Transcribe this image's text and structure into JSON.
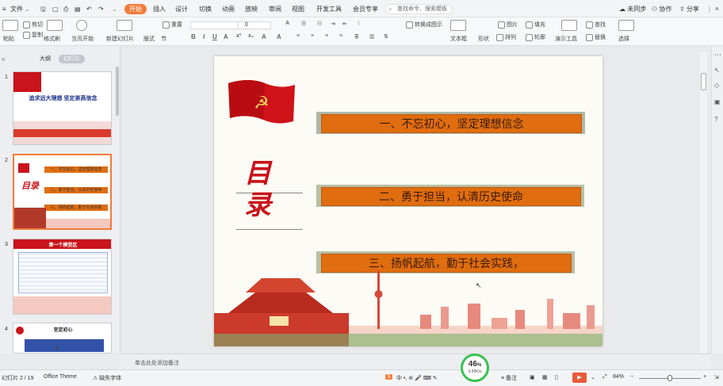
{
  "menubar": {
    "file_label": "文件",
    "tabs": [
      "开始",
      "插入",
      "设计",
      "切换",
      "动画",
      "放映",
      "审阅",
      "视图",
      "开发工具",
      "会员专享"
    ],
    "search_placeholder": "查找命令、搜索模板",
    "right_items": [
      "未同步",
      "协作",
      "分享"
    ]
  },
  "ribbon": {
    "paste": "粘贴",
    "cut": "剪切",
    "copy": "复制",
    "format_painter": "格式刷",
    "from_start": "当页开始",
    "new_slide": "新建幻灯片",
    "layout": "版式",
    "section": "节",
    "reset": "重置",
    "font_size": "0",
    "text_box": "文本框",
    "shape": "形状",
    "arrange": "排列",
    "picture": "图片",
    "fill": "填充",
    "outline": "轮廓",
    "presentation_tools": "演示工具",
    "replace": "替换",
    "select": "选择",
    "find": "查找",
    "convert": "转换成图示"
  },
  "leftpanel": {
    "tabs": [
      "大纲",
      "幻灯片"
    ],
    "slides": [
      {
        "num": "1",
        "title": "追求远大理想 坚定崇高信念"
      },
      {
        "num": "2",
        "items": [
          "一、不忘初心，坚定理想信念",
          "二、勇于担当，认清历史使命",
          "三、扬帆起航，勤于社会实践"
        ]
      },
      {
        "num": "3",
        "title": "第一个模型区"
      },
      {
        "num": "4",
        "title": "坚定初心"
      }
    ],
    "add_symbol": "+"
  },
  "slide": {
    "heading": "目录",
    "items": [
      "一、不忘初心，坚定理想信念",
      "二、勇于担当，认清历史使命",
      "三、扬帆起航，勤于社会实践，"
    ]
  },
  "notes": {
    "placeholder": "单击此处添加备注"
  },
  "status": {
    "slide_counter": "幻灯片 2 / 19",
    "theme": "Office Theme",
    "font_missing": "缺失字体",
    "notes_label": "备注",
    "zoom": "84%",
    "zoom_circle_value": "46",
    "zoom_circle_unit": "%",
    "zoom_circle_sub": "0.95K/s"
  },
  "colors": {
    "accent": "#f07c3a",
    "slide_bar": "#e06d10",
    "heading_red": "#c8141a",
    "green": "#36c24f"
  }
}
